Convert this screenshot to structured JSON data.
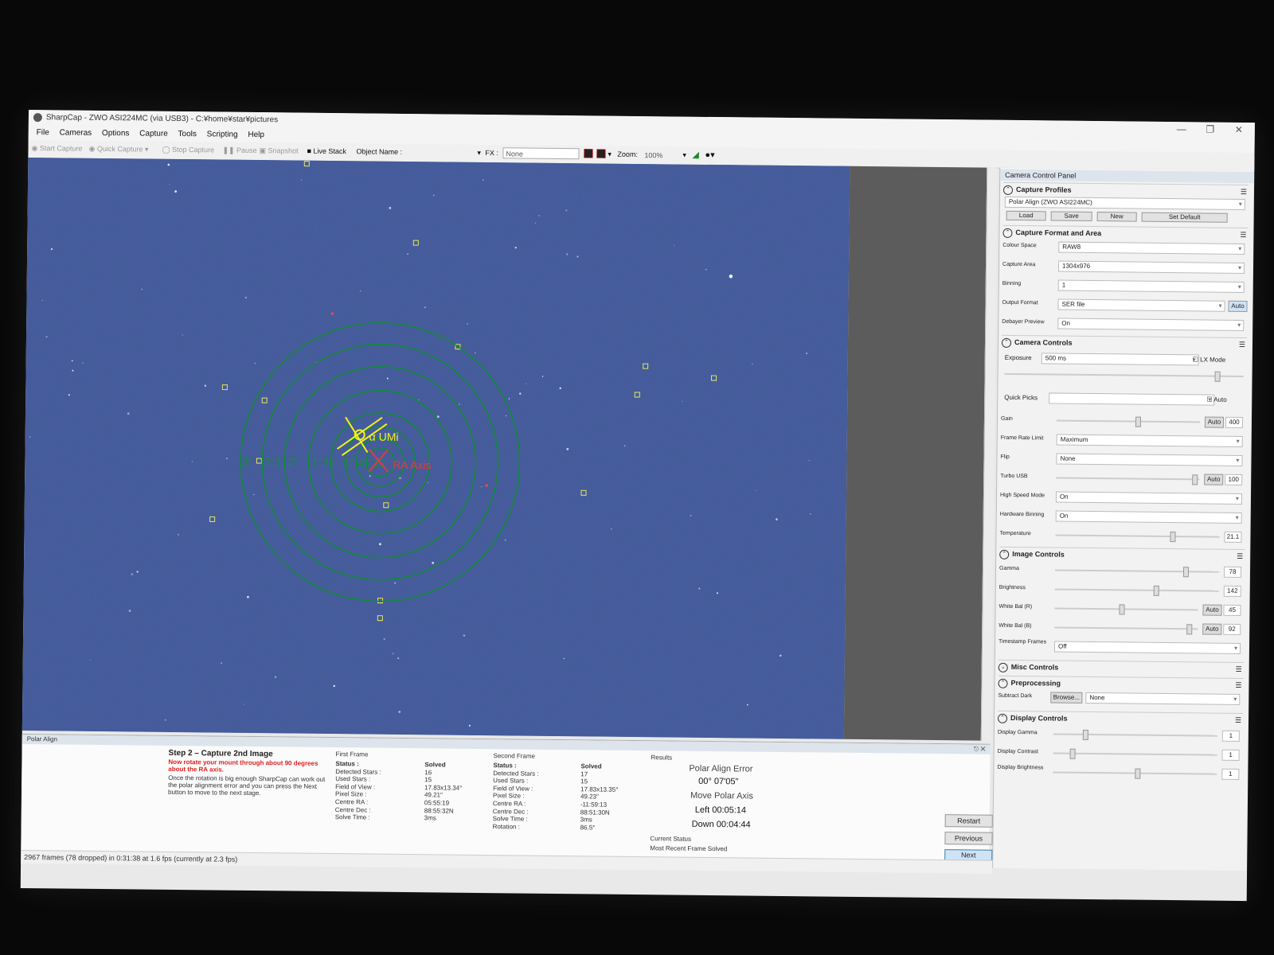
{
  "window": {
    "title": "SharpCap - ZWO ASI224MC (via USB3) - C:¥home¥star¥pictures",
    "controls": [
      "—",
      "❐",
      "✕"
    ]
  },
  "menu": [
    "File",
    "Cameras",
    "Options",
    "Capture",
    "Tools",
    "Scripting",
    "Help"
  ],
  "toolbar": {
    "start_capture": "Start Capture",
    "quick_capture": "Quick Capture",
    "stop_capture": "Stop Capture",
    "pause": "Pause",
    "snapshot": "Snapshot",
    "live_stack": "Live Stack",
    "object_name_label": "Object Name :",
    "fx_label": "FX :",
    "fx_value": "None",
    "zoom_label": "Zoom:",
    "zoom_value": "100%"
  },
  "overlay": {
    "star_label": "α UMi",
    "axis_label": "RA Axis",
    "ring_labels": [
      "3°",
      "2°3",
      "2°",
      "1°30",
      "1°",
      "45",
      "30'"
    ]
  },
  "panel": {
    "title": "Camera Control Panel",
    "capture_profiles": {
      "heading": "Capture Profiles",
      "profile": "Polar Align (ZWO ASI224MC)",
      "buttons": [
        "Load",
        "Save",
        "New",
        "Set Default"
      ]
    },
    "format_area": {
      "heading": "Capture Format and Area",
      "colour_space_label": "Colour Space",
      "colour_space": "RAW8",
      "capture_area_label": "Capture Area",
      "capture_area": "1304x976",
      "binning_label": "Binning",
      "binning": "1",
      "output_format_label": "Output Format",
      "output_format": "SER file",
      "output_auto": "Auto",
      "debayer_label": "Debayer Preview",
      "debayer": "On"
    },
    "camera_controls": {
      "heading": "Camera Controls",
      "exposure_label": "Exposure",
      "exposure": "500 ms",
      "lx_mode": "LX Mode",
      "quick_picks_label": "Quick Picks",
      "quick_picks_auto": "Auto",
      "gain_label": "Gain",
      "gain_auto": "Auto",
      "gain": "400",
      "gain_level": 0.55,
      "frame_rate_label": "Frame Rate Limit",
      "frame_rate": "Maximum",
      "flip_label": "Flip",
      "flip": "None",
      "turbo_label": "Turbo USB",
      "turbo_auto": "Auto",
      "turbo": "100",
      "turbo_level": 0.95,
      "high_speed_label": "High Speed Mode",
      "high_speed": "On",
      "hw_binning_label": "Hardware Binning",
      "hw_binning": "On",
      "temperature_label": "Temperature",
      "temperature": "21.1",
      "temperature_level": 0.7
    },
    "image_controls": {
      "heading": "Image Controls",
      "gamma_label": "Gamma",
      "gamma": "78",
      "gamma_level": 0.78,
      "brightness_label": "Brightness",
      "brightness": "142",
      "brightness_level": 0.6,
      "wb_r_label": "White Bal (R)",
      "wb_r_auto": "Auto",
      "wb_r": "45",
      "wb_r_level": 0.45,
      "wb_b_label": "White Bal (B)",
      "wb_b_auto": "Auto",
      "wb_b": "92",
      "wb_b_level": 0.92,
      "timestamp_label": "Timestamp Frames",
      "timestamp": "Off"
    },
    "misc_heading": "Misc Controls",
    "preprocessing": {
      "heading": "Preprocessing",
      "subtract_dark_label": "Subtract Dark",
      "browse": "Browse...",
      "dark_value": "None"
    },
    "display": {
      "heading": "Display Controls",
      "gamma_label": "Display Gamma",
      "gamma": "1",
      "gamma_level": 0.18,
      "contrast_label": "Display Contrast",
      "contrast": "1",
      "contrast_level": 0.1,
      "brightness_label": "Display Brightness",
      "brightness": "1",
      "brightness_level": 0.5
    }
  },
  "polar_align": {
    "title": "Polar Align",
    "step_title": "Step 2 – Capture 2nd Image",
    "instruction_red": "Now rotate your mount through about 90 degrees about the RA axis.",
    "instruction": "Once the rotation is big enough SharpCap can work out the polar alignment error and you can press the Next button to move to the next stage.",
    "first": {
      "heading": "First Frame",
      "labels": [
        "Status :",
        "Detected Stars :",
        "Used Stars :",
        "Field of View :",
        "Pixel Size :",
        "Centre RA :",
        "Centre Dec :",
        "Solve Time :"
      ],
      "values": [
        "Solved",
        "16",
        "15",
        "17.83x13.34°",
        "49.21\"",
        "05:55:19",
        "88:55:32N",
        "3ms"
      ]
    },
    "second": {
      "heading": "Second Frame",
      "labels": [
        "Status :",
        "Detected Stars :",
        "Used Stars :",
        "Field of View :",
        "Pixel Size :",
        "Centre RA :",
        "Centre Dec :",
        "Solve Time :",
        "Rotation :"
      ],
      "values": [
        "Solved",
        "17",
        "15",
        "17.83x13.35°",
        "49.23\"",
        "-11:59:13",
        "88:51:30N",
        "3ms",
        "86.5°"
      ]
    },
    "results": {
      "heading": "Results",
      "error_label": "Polar Align Error",
      "error_value": "00° 07'05\"",
      "move_label": "Move Polar Axis",
      "left": "Left 00:05:14",
      "down": "Down 00:04:44",
      "current_status_label": "Current Status",
      "current_status": "Most Recent Frame Solved"
    },
    "buttons": {
      "restart": "Restart",
      "previous": "Previous",
      "next": "Next"
    }
  },
  "status_bar": "2967 frames (78 dropped) in 0:31:38 at 1.6 fps  (currently at 2.3 fps)",
  "colors": {
    "sky": "#41589a",
    "ring": "#138a3a",
    "crosshair": "#f2f21a",
    "ra_axis": "#e03c3c"
  }
}
